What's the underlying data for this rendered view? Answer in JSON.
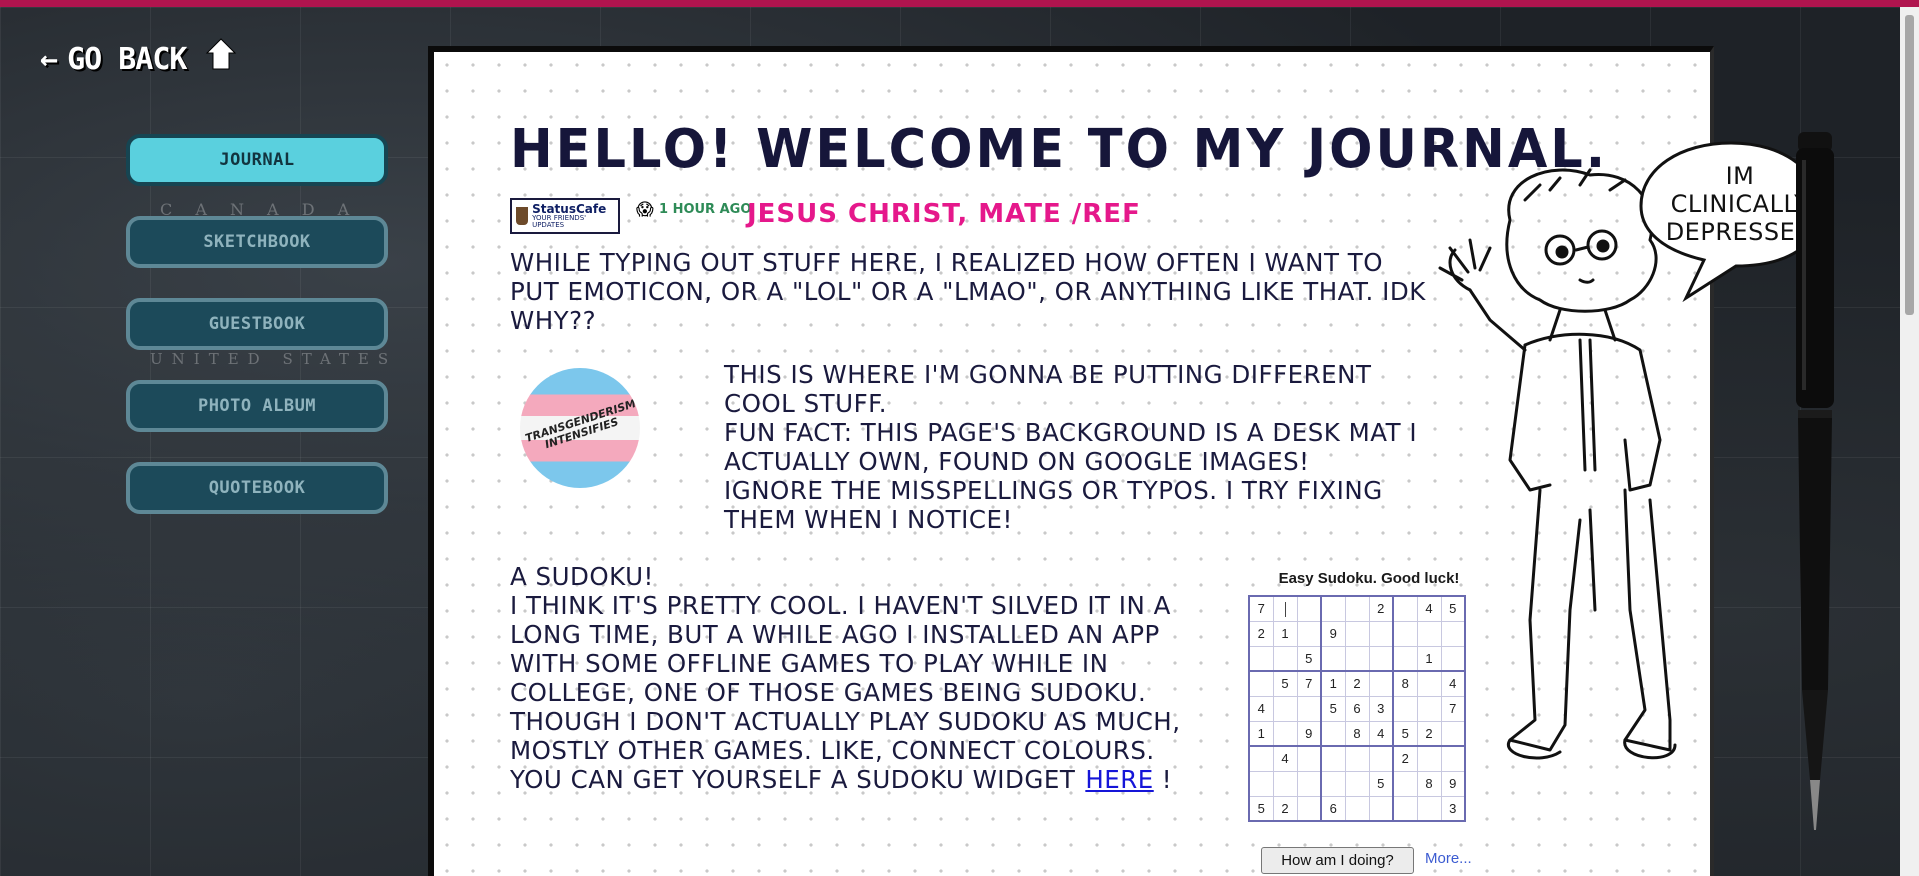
{
  "nav": {
    "go_back": "GO BACK",
    "items": [
      {
        "label": "JOURNAL",
        "active": true
      },
      {
        "label": "SKETCHBOOK",
        "active": false
      },
      {
        "label": "GUESTBOOK",
        "active": false
      },
      {
        "label": "PHOTO ALBUM",
        "active": false
      },
      {
        "label": "QUOTEBOOK",
        "active": false
      }
    ]
  },
  "map_labels": [
    "C A N A D A",
    "UNITED STATES"
  ],
  "journal": {
    "title": "HELLO! WELCOME TO MY JOURNAL.",
    "status": {
      "widget_title": "StatusCafe",
      "widget_sub": "YOUR FRIENDS' UPDATES",
      "emoji": "😱",
      "time_ago": "1 HOUR AGO",
      "message": "JESUS CHRIST, MATE /REF"
    },
    "para1": "WHILE TYPING OUT STUFF HERE, I REALIZED HOW OFTEN I WANT TO PUT EMOTICON, OR A \"LOL\" OR A \"LMAO\", OR ANYTHING LIKE THAT. IDK WHY??",
    "badge_text": "TRANSGENDERISM INTENSIFIES",
    "para2": [
      "THIS IS WHERE I'M GONNA BE PUTTING DIFFERENT COOL STUFF.",
      "FUN FACT: THIS PAGE'S BACKGROUND IS A DESK MAT I ACTUALLY OWN, FOUND ON GOOGLE IMAGES!",
      "IGNORE THE MISSPELLINGS OR TYPOS. I TRY FIXING THEM WHEN I NOTICE!"
    ],
    "para3_heading": "A SUDOKU!",
    "para3": "I THINK IT'S PRETTY COOL. I HAVEN'T SILVED IT IN A LONG TIME, BUT A WHILE AGO I INSTALLED AN APP WITH SOME OFFLINE GAMES TO PLAY WHILE IN COLLEGE, ONE OF THOSE GAMES BEING SUDOKU. THOUGH I DON'T ACTUALLY PLAY SUDOKU AS MUCH, MOSTLY OTHER GAMES. LIKE, CONNECT COLOURS.",
    "para3_link_prefix": "YOU CAN GET YOURSELF A SUDOKU WIDGET",
    "para3_link": "HERE",
    "para3_suffix": "!",
    "speech_bubble": "IM CLINICALLY DEPRESSED"
  },
  "sudoku": {
    "title": "Easy Sudoku. Good luck!",
    "grid": [
      [
        "7",
        "",
        "",
        "",
        "",
        "2",
        "",
        "4",
        "5"
      ],
      [
        "2",
        "1",
        "",
        "9",
        "",
        "",
        "",
        "",
        ""
      ],
      [
        "",
        "",
        "5",
        "",
        "",
        "",
        "",
        "1",
        ""
      ],
      [
        "",
        "5",
        "7",
        "1",
        "2",
        "",
        "8",
        "",
        "4"
      ],
      [
        "4",
        "",
        "",
        "5",
        "6",
        "3",
        "",
        "",
        "7"
      ],
      [
        "1",
        "",
        "9",
        "",
        "8",
        "4",
        "5",
        "2",
        ""
      ],
      [
        "",
        "4",
        "",
        "",
        "",
        "",
        "2",
        "",
        ""
      ],
      [
        "",
        "",
        "",
        "",
        "",
        "5",
        "",
        "8",
        "9"
      ],
      [
        "5",
        "2",
        "",
        "6",
        "",
        "",
        "",
        "",
        "3"
      ]
    ],
    "check_button": "How am I doing?",
    "more_link": "More..."
  }
}
